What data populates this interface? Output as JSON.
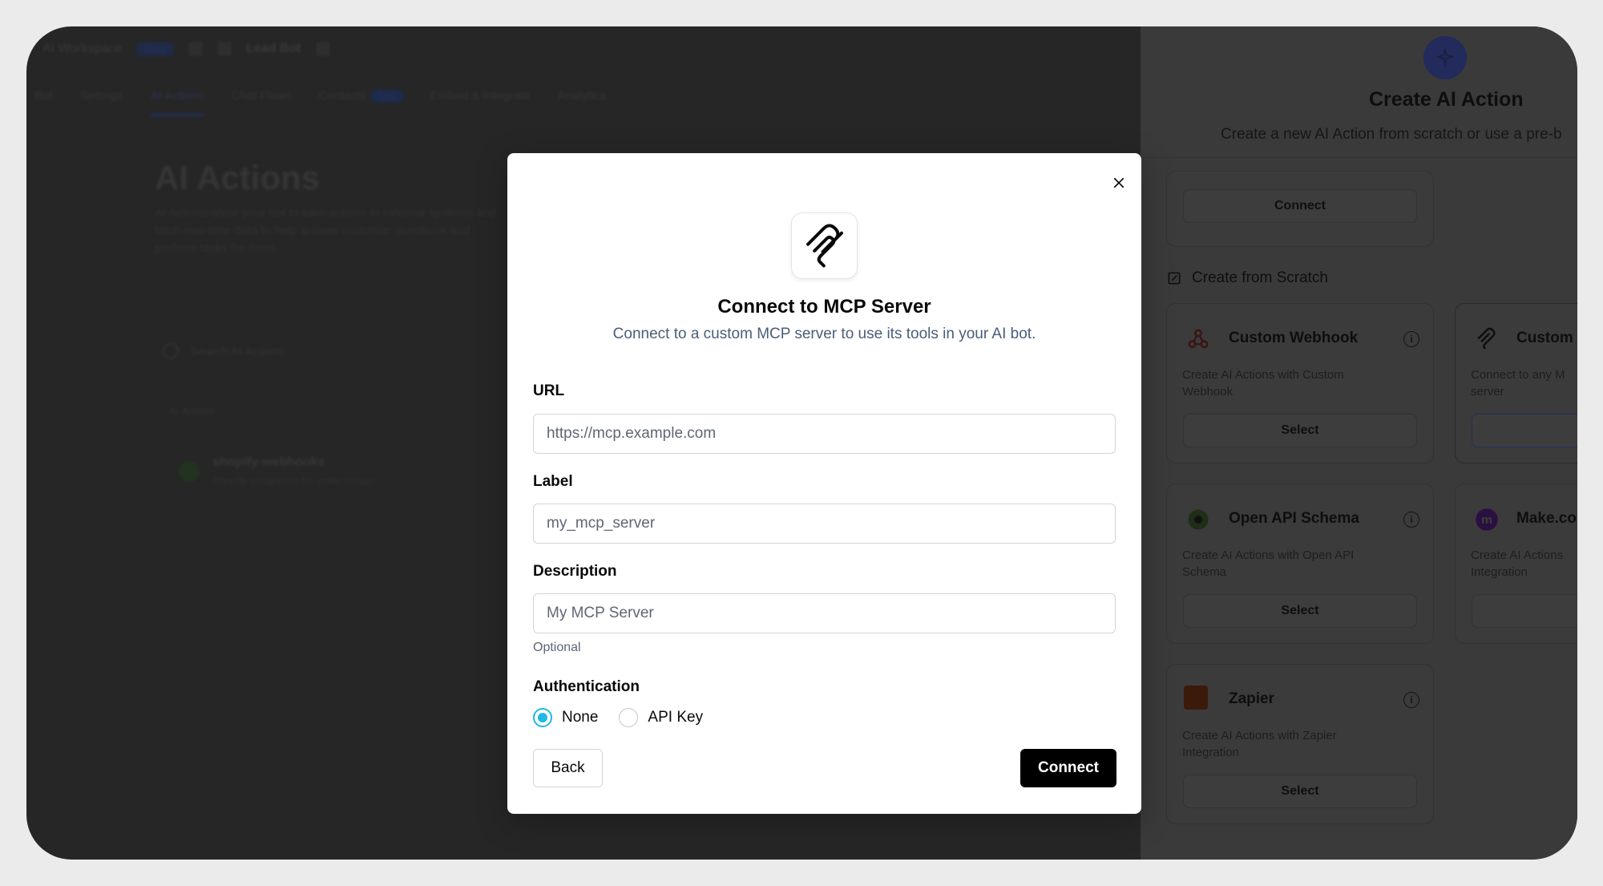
{
  "background": {
    "workspace_label": "AI Workspace",
    "workspace_badge": "Beta",
    "bot_name": "Lead Bot",
    "tabs": [
      {
        "label": "Bot"
      },
      {
        "label": "Settings"
      },
      {
        "label": "AI Actions"
      },
      {
        "label": "Chat Flows"
      },
      {
        "label": "Contacts",
        "badge": "New"
      },
      {
        "label": "Embed & Integrate"
      },
      {
        "label": "Analytics"
      }
    ],
    "page_title": "AI Actions",
    "page_desc": "AI Actions allow your bot to take actions in external systems and fetch real-time data to help answer customer questions and perform tasks for them.",
    "search_placeholder": "Search AI Actions",
    "section_label": "AI Actions",
    "row_title": "shopify-webhooks",
    "row_subtitle": "Shopify integration for order lookup"
  },
  "panel": {
    "title": "Create AI Action",
    "subtitle": "Create a new AI Action from scratch or use a pre-b",
    "connect_label": "Connect",
    "scratch_heading": "Create from Scratch",
    "cards": [
      {
        "name": "Custom Webhook",
        "desc": "Create AI Actions with Custom Webhook",
        "button": "Select",
        "icon": "webhook-icon"
      },
      {
        "name": "Custom",
        "desc": "Connect to any M server",
        "button": "S",
        "icon": "mcp-icon"
      },
      {
        "name": "Open API Schema",
        "desc": "Create AI Actions with Open API Schema",
        "button": "Select",
        "icon": "openapi-icon"
      },
      {
        "name": "Make.co",
        "desc": "Create AI Actions Integration",
        "button": "S",
        "icon": "make-icon"
      },
      {
        "name": "Zapier",
        "desc": "Create AI Actions with Zapier Integration",
        "button": "Select",
        "icon": "zapier-icon"
      }
    ]
  },
  "modal": {
    "title": "Connect to MCP Server",
    "subtitle": "Connect to a custom MCP server to use its tools in your AI bot.",
    "url_label": "URL",
    "url_placeholder": "https://mcp.example.com",
    "label_label": "Label",
    "label_placeholder": "my_mcp_server",
    "description_label": "Description",
    "description_placeholder": "My MCP Server",
    "description_hint": "Optional",
    "auth_label": "Authentication",
    "auth_options": [
      {
        "label": "None",
        "selected": true
      },
      {
        "label": "API Key",
        "selected": false
      }
    ],
    "back_label": "Back",
    "connect_label": "Connect"
  },
  "colors": {
    "accent": "#22b8e6",
    "primary_button": "#000000",
    "subtitle_text": "#4b5d79"
  }
}
